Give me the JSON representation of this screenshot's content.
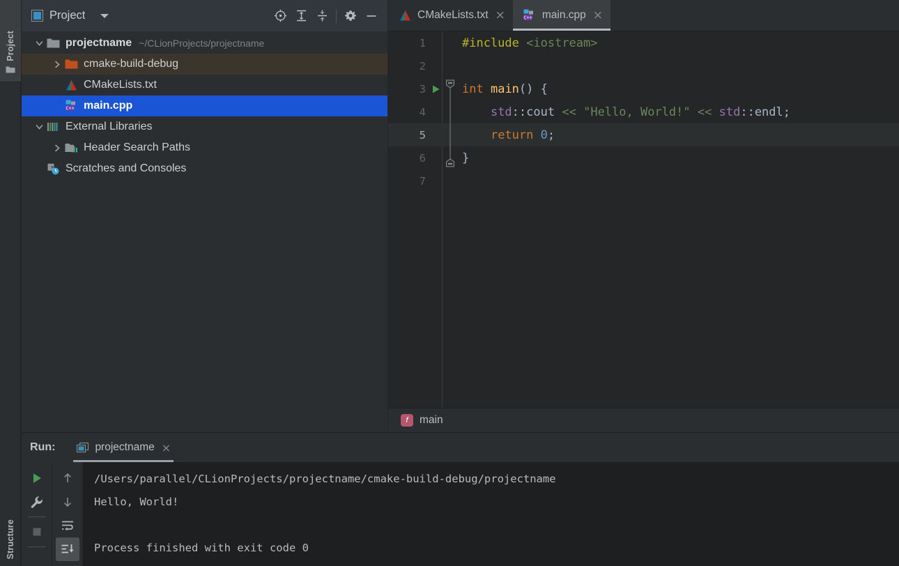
{
  "colors": {
    "selection_blue": "#1a55d6",
    "hover_brown": "#3b352b",
    "panel_bg": "#2b2e30",
    "editor_bg": "#242627",
    "console_bg": "#1e1f20",
    "project_header_bg": "#31373c",
    "run_green": "#499c54",
    "breadcrumb_pink": "#b5576e"
  },
  "toolstrip": {
    "buttons": [
      {
        "label": "Project",
        "icon": "folder-icon",
        "active": true
      },
      {
        "label": "Structure",
        "icon": "structure-icon",
        "active": false
      }
    ]
  },
  "project_panel": {
    "header": {
      "icon": "project-window-icon",
      "title": "Project",
      "dropdown_icon": "chevron-down-icon",
      "actions": [
        {
          "name": "scroll-from-source",
          "icon": "crosshair-icon"
        },
        {
          "name": "expand-all",
          "icon": "expand-all-icon"
        },
        {
          "name": "collapse-all",
          "icon": "collapse-all-icon"
        },
        {
          "name": "settings",
          "icon": "gear-icon"
        },
        {
          "name": "hide",
          "icon": "minimize-icon"
        }
      ]
    },
    "tree": [
      {
        "label": "projectname",
        "path": "~/CLionProjects/projectname",
        "icon": "folder-icon",
        "arrow": "expanded",
        "indent": 0,
        "bold": true,
        "state": "normal"
      },
      {
        "label": "cmake-build-debug",
        "path": "",
        "icon": "folder-excluded-icon",
        "arrow": "collapsed",
        "indent": 1,
        "bold": false,
        "state": "hover"
      },
      {
        "label": "CMakeLists.txt",
        "path": "",
        "icon": "cmake-file-icon",
        "arrow": "none",
        "indent": 1,
        "bold": false,
        "state": "normal"
      },
      {
        "label": "main.cpp",
        "path": "",
        "icon": "cpp-file-icon",
        "arrow": "none",
        "indent": 1,
        "bold": true,
        "state": "selected"
      },
      {
        "label": "External Libraries",
        "path": "",
        "icon": "libraries-icon",
        "arrow": "expanded",
        "indent": 0,
        "bold": false,
        "state": "normal"
      },
      {
        "label": "Header Search Paths",
        "path": "",
        "icon": "header-paths-icon",
        "arrow": "collapsed",
        "indent": 1,
        "bold": false,
        "state": "normal"
      },
      {
        "label": "Scratches and Consoles",
        "path": "",
        "icon": "scratches-icon",
        "arrow": "none",
        "indent": 0,
        "bold": false,
        "state": "normal"
      }
    ]
  },
  "editor": {
    "tabs": [
      {
        "label": "CMakeLists.txt",
        "icon": "cmake-file-icon",
        "close": "×",
        "active": false
      },
      {
        "label": "main.cpp",
        "icon": "cpp-file-icon",
        "close": "×",
        "active": true
      }
    ],
    "lines": [
      {
        "num": "1",
        "current": false,
        "run_marker": false,
        "fold": "none",
        "tokens": [
          {
            "text": "#include",
            "cls": "t-pp"
          },
          {
            "text": " ",
            "cls": "t-plain"
          },
          {
            "text": "<iostream>",
            "cls": "t-inc"
          }
        ]
      },
      {
        "num": "2",
        "current": false,
        "run_marker": false,
        "fold": "none",
        "tokens": []
      },
      {
        "num": "3",
        "current": false,
        "run_marker": true,
        "fold": "open",
        "tokens": [
          {
            "text": "int",
            "cls": "t-kw"
          },
          {
            "text": " ",
            "cls": "t-plain"
          },
          {
            "text": "main",
            "cls": "t-fn"
          },
          {
            "text": "() {",
            "cls": "t-plain"
          }
        ]
      },
      {
        "num": "4",
        "current": false,
        "run_marker": false,
        "fold": "line",
        "tokens": [
          {
            "text": "    ",
            "cls": "t-plain"
          },
          {
            "text": "std",
            "cls": "t-ns"
          },
          {
            "text": "::",
            "cls": "t-plain"
          },
          {
            "text": "cout",
            "cls": "t-plain"
          },
          {
            "text": " ",
            "cls": "t-plain"
          },
          {
            "text": "<<",
            "cls": "t-inc"
          },
          {
            "text": " ",
            "cls": "t-plain"
          },
          {
            "text": "\"Hello, World!\"",
            "cls": "t-str"
          },
          {
            "text": " ",
            "cls": "t-plain"
          },
          {
            "text": "<<",
            "cls": "t-inc"
          },
          {
            "text": " ",
            "cls": "t-plain"
          },
          {
            "text": "std",
            "cls": "t-ns"
          },
          {
            "text": "::",
            "cls": "t-plain"
          },
          {
            "text": "endl",
            "cls": "t-plain"
          },
          {
            "text": ";",
            "cls": "t-plain"
          }
        ]
      },
      {
        "num": "5",
        "current": true,
        "run_marker": false,
        "fold": "line",
        "tokens": [
          {
            "text": "    ",
            "cls": "t-plain"
          },
          {
            "text": "return",
            "cls": "t-kw"
          },
          {
            "text": " ",
            "cls": "t-plain"
          },
          {
            "text": "0",
            "cls": "t-num"
          },
          {
            "text": ";",
            "cls": "t-plain"
          }
        ]
      },
      {
        "num": "6",
        "current": false,
        "run_marker": false,
        "fold": "close",
        "tokens": [
          {
            "text": "}",
            "cls": "t-plain"
          }
        ]
      },
      {
        "num": "7",
        "current": false,
        "run_marker": false,
        "fold": "none",
        "tokens": []
      }
    ],
    "breadcrumb": {
      "icon": "function-icon",
      "icon_glyph": "f",
      "label": "main"
    }
  },
  "run_panel": {
    "header": {
      "label": "Run:",
      "tab": {
        "icon": "run-config-icon",
        "label": "projectname",
        "close": "×"
      }
    },
    "toolbar_left": [
      {
        "name": "rerun-button",
        "icon": "play-icon"
      },
      {
        "name": "edit-configuration-button",
        "icon": "wrench-icon"
      },
      {
        "name": "stop-button",
        "icon": "stop-icon"
      }
    ],
    "toolbar_right": [
      {
        "name": "previous-occurrence-button",
        "icon": "arrow-up-icon"
      },
      {
        "name": "next-occurrence-button",
        "icon": "arrow-down-icon"
      },
      {
        "name": "soft-wrap-button",
        "icon": "soft-wrap-icon"
      },
      {
        "name": "scroll-to-end-button",
        "icon": "scroll-to-end-icon",
        "active": true
      }
    ],
    "console_lines": [
      "/Users/parallel/CLionProjects/projectname/cmake-build-debug/projectname",
      "Hello, World!",
      "",
      "Process finished with exit code 0"
    ]
  }
}
